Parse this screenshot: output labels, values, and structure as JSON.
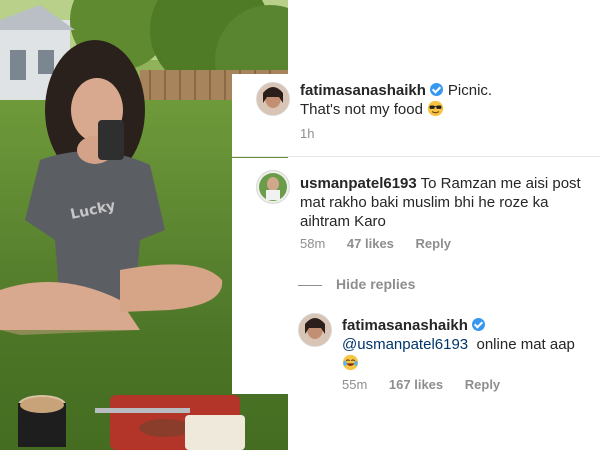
{
  "post": {
    "username": "fatimasanashaikh",
    "caption_line1": "Picnic.",
    "caption_line2": "That's not my food",
    "caption_emoji": "sunglasses-face-emoji",
    "time": "1h"
  },
  "comment": {
    "username": "usmanpatel6193",
    "text": "To Ramzan me aisi post mat rakho baki muslim bhi he roze ka aihtram Karo",
    "time": "58m",
    "likes": "47 likes",
    "reply_label": "Reply"
  },
  "hide_replies_label": "Hide replies",
  "reply": {
    "username": "fatimasanashaikh",
    "mention": "@usmanpatel6193",
    "text": "online mat aap",
    "emoji": "tears-of-joy-emoji",
    "time": "55m",
    "likes": "167 likes",
    "reply_label": "Reply"
  },
  "colors": {
    "verified_badge": "#3897f0",
    "meta_gray": "#8e8e8e",
    "text": "#262626",
    "grass": "#4f7a2a",
    "tshirt": "#5b5e63"
  }
}
